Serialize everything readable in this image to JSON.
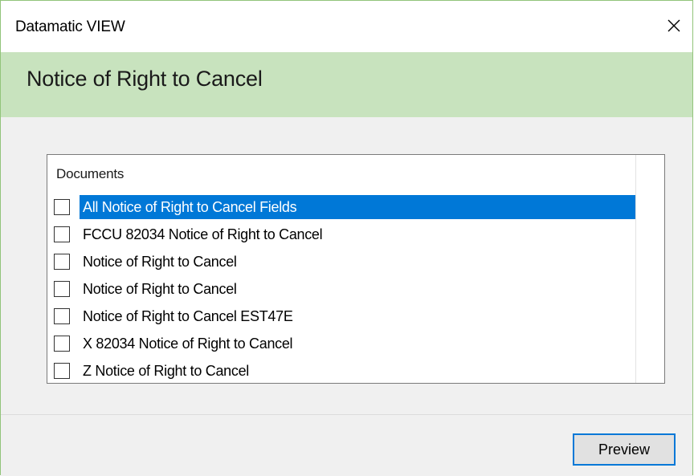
{
  "window": {
    "title": "Datamatic VIEW",
    "close_icon": "close-icon"
  },
  "header": {
    "title": "Notice of Right to Cancel"
  },
  "documents": {
    "header": "Documents",
    "items": [
      {
        "label": "All Notice of Right to Cancel Fields",
        "checked": false,
        "selected": true
      },
      {
        "label": "FCCU 82034 Notice of Right to Cancel",
        "checked": false,
        "selected": false
      },
      {
        "label": "Notice of Right to Cancel",
        "checked": false,
        "selected": false
      },
      {
        "label": "Notice of Right to Cancel",
        "checked": false,
        "selected": false
      },
      {
        "label": "Notice of Right to Cancel EST47E",
        "checked": false,
        "selected": false
      },
      {
        "label": "X 82034 Notice of Right to Cancel",
        "checked": false,
        "selected": false
      },
      {
        "label": "Z Notice of Right to Cancel",
        "checked": false,
        "selected": false
      }
    ]
  },
  "footer": {
    "preview_label": "Preview"
  },
  "colors": {
    "header_band": "#c8e3be",
    "window_border": "#92c47a",
    "selection": "#0078d7",
    "dialog_bg": "#f0f0f0"
  }
}
